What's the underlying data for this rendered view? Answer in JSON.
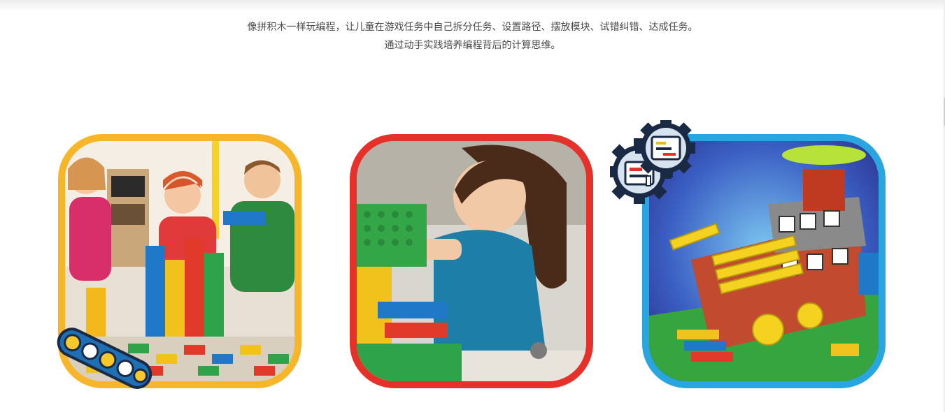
{
  "intro": {
    "line1": "像拼积木一样玩编程，让儿童在游戏任务中自己拆分任务、设置路径、摆放模块、试错纠错、达成任务。",
    "line2": "通过动手实践培养编程背后的计算思维。"
  },
  "cards": [
    {
      "frame_color": "#f7b529",
      "badge_icon": "brick-beam-icon"
    },
    {
      "frame_color": "#e5312a"
    },
    {
      "frame_color": "#29a5df",
      "badge_icon": "gear-code-icon"
    }
  ]
}
